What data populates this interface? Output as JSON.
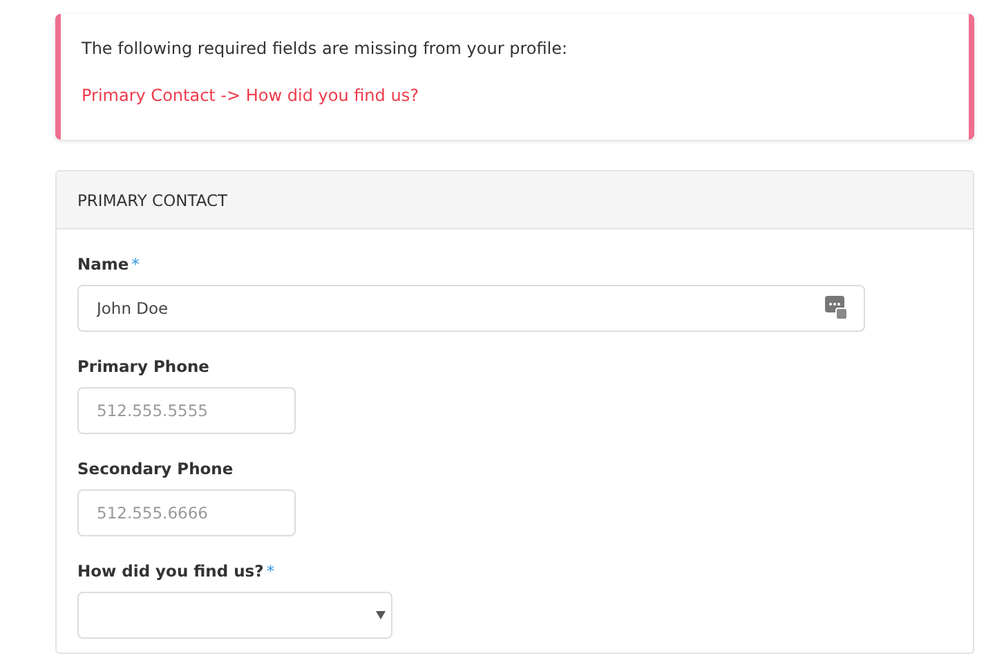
{
  "alert": {
    "message": "The following required fields are missing from your profile:",
    "missing": "Primary Contact -> How did you find us?"
  },
  "section": {
    "title": "PRIMARY CONTACT",
    "fields": [
      {
        "kind": "text",
        "label": "Name",
        "mark": "*",
        "value": "John Doe",
        "autofill_icon": true
      },
      {
        "kind": "text",
        "label": "Primary Phone",
        "placeholder": "512.555.5555"
      },
      {
        "kind": "text",
        "label": "Secondary Phone",
        "placeholder": "512.555.6666"
      },
      {
        "kind": "select",
        "label": "How did you find us?",
        "mark": "*"
      }
    ]
  }
}
